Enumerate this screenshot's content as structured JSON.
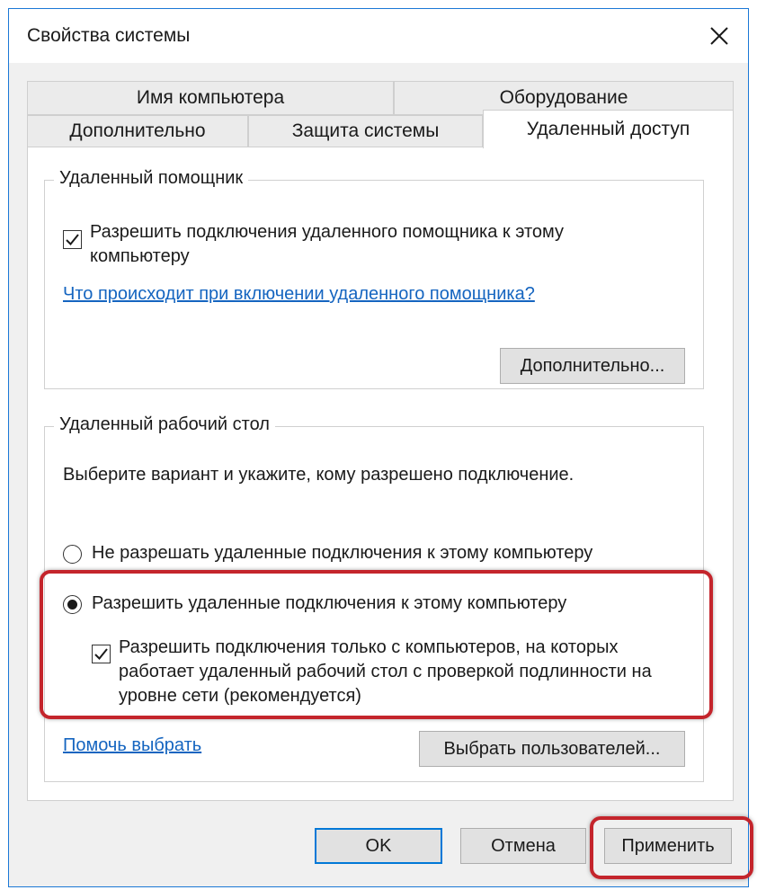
{
  "window": {
    "title": "Свойства системы"
  },
  "tabs": {
    "row_back": [
      "Имя компьютера",
      "Оборудование"
    ],
    "row_front": [
      "Дополнительно",
      "Защита системы",
      "Удаленный доступ"
    ],
    "active": "Удаленный доступ"
  },
  "assistance": {
    "group_title": "Удаленный помощник",
    "checkbox_label": "Разрешить подключения удаленного помощника к этому компьютеру",
    "checkbox_checked": true,
    "help_link": "Что происходит при включении удаленного помощника?",
    "advanced_button": "Дополнительно..."
  },
  "desktop": {
    "group_title": "Удаленный рабочий стол",
    "instruction": "Выберите вариант и укажите, кому разрешено подключение.",
    "radio_deny": "Не разрешать удаленные подключения к этому компьютеру",
    "radio_allow": "Разрешить удаленные подключения к этому компьютеру",
    "selected_option": "allow",
    "nla_checkbox_label": "Разрешить подключения только с компьютеров, на которых работает удаленный рабочий стол с проверкой подлинности на уровне сети (рекомендуется)",
    "nla_checked": true,
    "help_choose_link": "Помочь выбрать",
    "select_users_button": "Выбрать пользователей..."
  },
  "footer": {
    "ok": "OK",
    "cancel": "Отмена",
    "apply": "Применить"
  },
  "colors": {
    "accent": "#0078d7",
    "link": "#1565c0",
    "highlight": "#c4252c"
  }
}
